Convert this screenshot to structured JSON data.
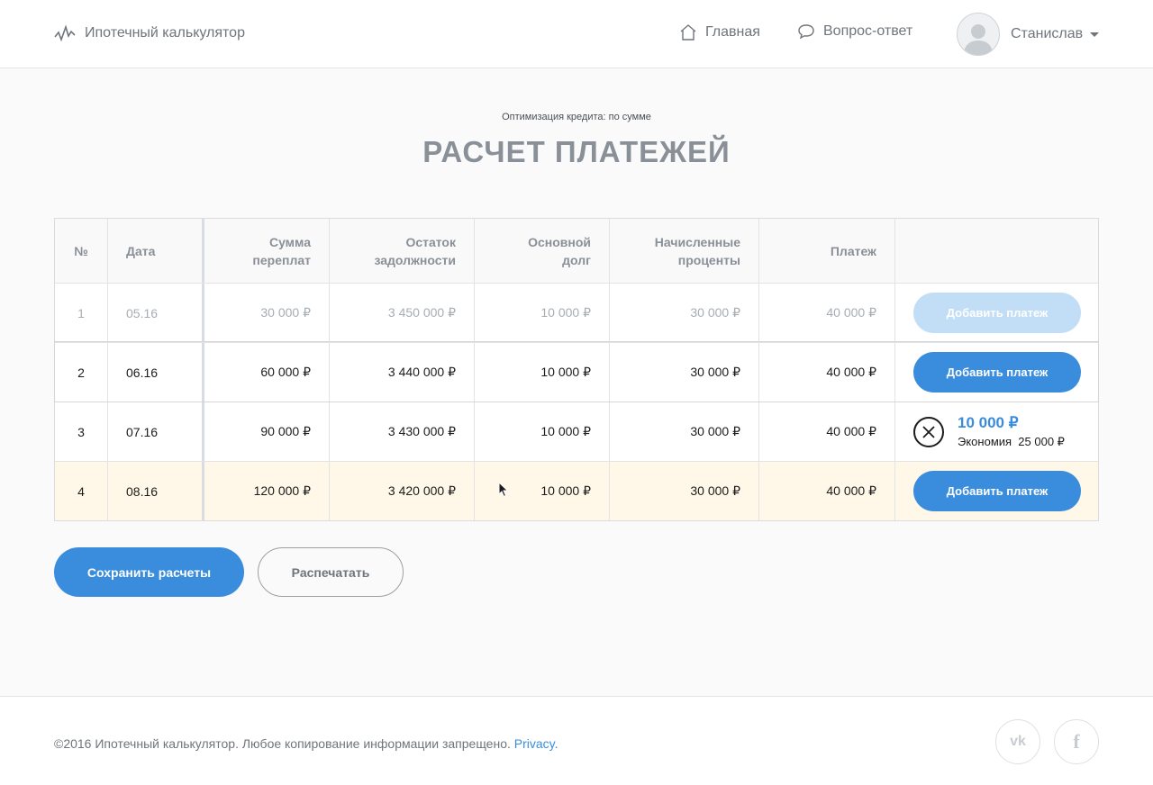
{
  "header": {
    "logo_text": "Ипотечный калькулятор",
    "nav": [
      {
        "label": "Главная",
        "icon": "home-icon"
      },
      {
        "label": "Вопрос-ответ",
        "icon": "speech-bubble-icon"
      }
    ],
    "user_name": "Станислав"
  },
  "page": {
    "subtitle": "Оптимизация кредита: по сумме",
    "title": "РАСЧЕТ ПЛАТЕЖЕЙ"
  },
  "table": {
    "columns": [
      "№",
      "Дата",
      "Сумма переплат",
      "Остаток задолжности",
      "Основной долг",
      "Начисленные проценты",
      "Платеж",
      ""
    ],
    "rows": [
      {
        "num": "1",
        "date": "05.16",
        "overpay": "30 000 ₽",
        "remainder": "3 450 000 ₽",
        "principal": "10 000 ₽",
        "interest": "30 000 ₽",
        "payment": "40 000 ₽",
        "action": "Добавить платеж",
        "state": "disabled"
      },
      {
        "num": "2",
        "date": "06.16",
        "overpay": "60 000 ₽",
        "remainder": "3 440 000 ₽",
        "principal": "10 000 ₽",
        "interest": "30 000 ₽",
        "payment": "40 000 ₽",
        "action": "Добавить платеж",
        "state": "active"
      },
      {
        "num": "3",
        "date": "07.16",
        "overpay": "90 000 ₽",
        "remainder": "3 430 000 ₽",
        "principal": "10 000 ₽",
        "interest": "30 000 ₽",
        "payment": "40 000 ₽",
        "extra_amount": "10 000 ₽",
        "extra_saving_label": "Экономия",
        "extra_saving_value": "25 000 ₽",
        "state": "extra"
      },
      {
        "num": "4",
        "date": "08.16",
        "overpay": "120 000 ₽",
        "remainder": "3 420 000 ₽",
        "principal": "10 000 ₽",
        "interest": "30 000 ₽",
        "payment": "40 000 ₽",
        "action": "Добавить платеж",
        "state": "highlight"
      }
    ]
  },
  "actions": {
    "save": "Сохранить расчеты",
    "print": "Распечатать"
  },
  "footer": {
    "copyright": "©2016 Ипотечный калькулятор. Любое копирование информации запрещено.",
    "privacy": "Privacy.",
    "social": [
      {
        "label": "vk",
        "icon": "vk-icon"
      },
      {
        "label": "f",
        "icon": "facebook-icon"
      }
    ]
  },
  "colors": {
    "accent": "#3a8ddc",
    "accent_disabled": "#c2def6",
    "highlight_row": "#fff8e8",
    "title": "#8a9098"
  }
}
